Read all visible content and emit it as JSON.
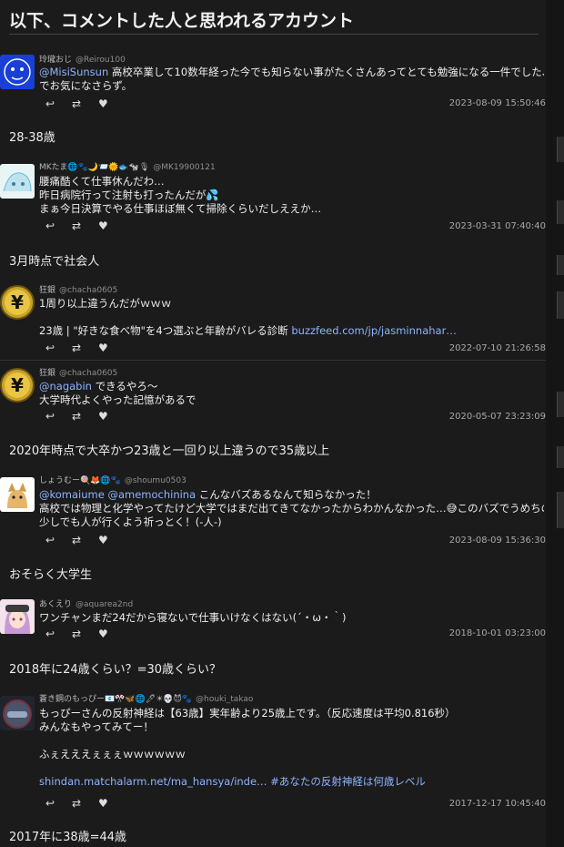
{
  "heading": "以下、コメントした人と思われるアカウント",
  "tweets": [
    {
      "name": "玲瓏おじ",
      "handle": "@Reirou100",
      "lines": [
        {
          "mention": "@MisiSunsun",
          "text": " 高校卒業して10数年経った今でも知らない事がたくさんあってとても勉強になる一件でした、なの"
        },
        {
          "text": "でお気になさらず。"
        }
      ],
      "date": "2023-08-09 15:50:46"
    },
    {
      "name": "MKたま🌐🐾🌙📨🌞🐟🐄🎙",
      "handle": "@MK19900121",
      "lines": [
        {
          "text": "腰痛酷くて仕事休んだわ…"
        },
        {
          "text": "昨日病院行って注射も打ったんだが💦"
        },
        {
          "text": "まぁ今日決算でやる仕事ほぼ無くて掃除くらいだしええか…"
        }
      ],
      "date": "2023-03-31 07:40:40"
    },
    {
      "name": "狂銀",
      "handle": "@chacha0605",
      "lines": [
        {
          "text": "1周り以上違うんだがｗｗｗ"
        },
        {
          "text": ""
        },
        {
          "text": "23歳 | \"好きな食べ物\"を4つ選ぶと年齢がバレる診断 ",
          "link": "buzzfeed.com/jp/jasminnahar…"
        }
      ],
      "date": "2022-07-10 21:26:58"
    },
    {
      "name": "狂銀",
      "handle": "@chacha0605",
      "lines": [
        {
          "mention": "@nagabin",
          "text": " できるやろ～"
        },
        {
          "text": "大学時代よくやった記憶があるで"
        }
      ],
      "date": "2020-05-07 23:23:09"
    },
    {
      "name": "しょうむー🍭🦊🌐🐾",
      "handle": "@shoumu0503",
      "lines": [
        {
          "text": "こんなバズあるなんて知らなかった！",
          "mention": "@komaiume @amemochinina "
        },
        {
          "text": "高校では物理と化学やってたけど大学ではまだ出てきてなかったからわかんなかった…😅このバズでうめちの所に"
        },
        {
          "text": "少しでも人が行くよう祈っとく！(-人-)"
        }
      ],
      "date": "2023-08-09 15:36:30"
    },
    {
      "name": "あくえり",
      "handle": "@aquarea2nd",
      "lines": [
        {
          "text": "ワンチャンまだ24だから寝ないで仕事いけなくはない(´・ω・｀)"
        }
      ],
      "date": "2018-10-01 03:23:00"
    },
    {
      "name": "蒼き鋼のもっぴー📧🎌🦋🌐🖊☀💀😈🐾",
      "handle": "@houki_takao",
      "lines": [
        {
          "text": "もっぴーさんの反射神経は【63歳】実年齢より25歳上です。（反応速度は平均0.816秒）"
        },
        {
          "text": "みんなもやってみてー！"
        },
        {
          "text": ""
        },
        {
          "text": "ふぇえええぇぇぇｗｗｗｗｗｗ"
        },
        {
          "text": ""
        },
        {
          "text": "",
          "link": " shindan.matchalarm.net/ma_hansya/inde… #あなたの反射神経は何歳レベル"
        }
      ],
      "date": "2017-12-17 10:45:40"
    }
  ],
  "notes": [
    "28-38歳",
    "3月時点で社会人",
    "2020年時点で大卒かつ23歳と一回り以上違うので35歳以上",
    "おそらく大学生",
    "2018年に24歳くらい？=30歳くらい？",
    "2017年に38歳=44歳"
  ],
  "action_icons": {
    "reply": "reply-icon",
    "retweet": "retweet-icon",
    "like": "heart-icon"
  },
  "colors": {
    "background": "#1b1b1b",
    "link": "#8fb4ff",
    "text": "#eeeeee"
  }
}
